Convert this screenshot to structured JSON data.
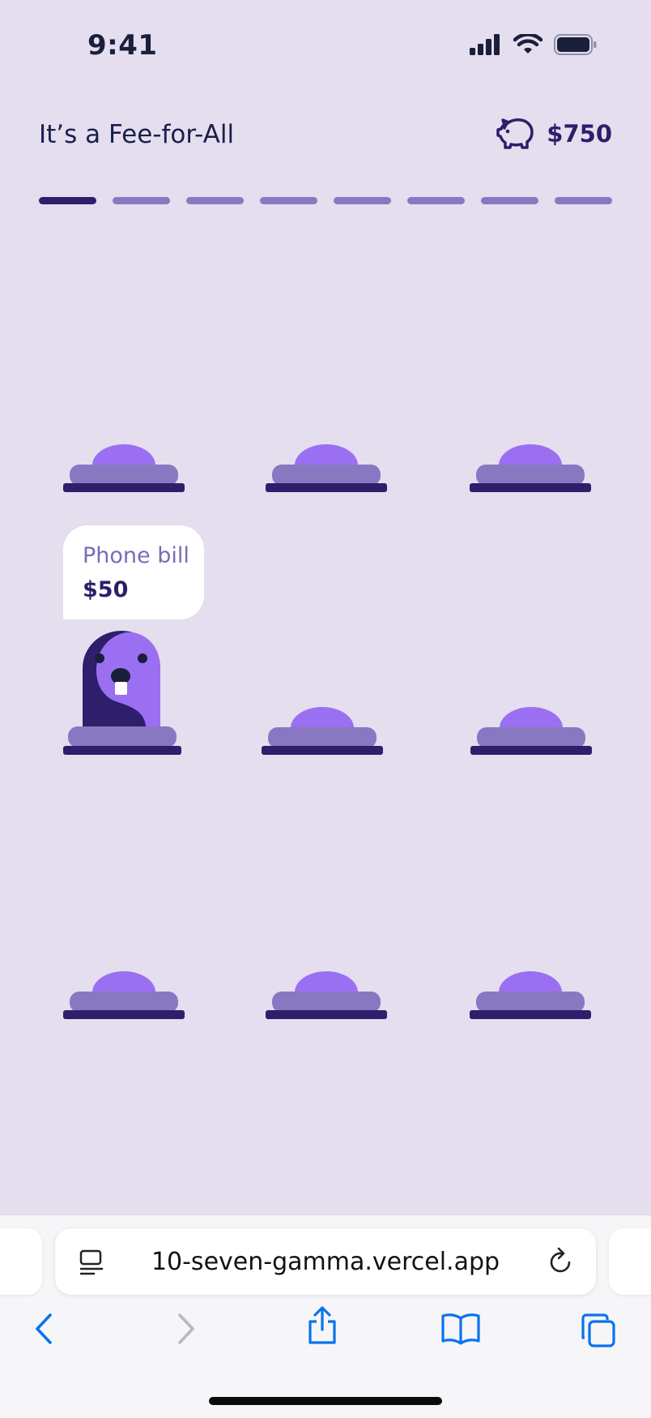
{
  "status_bar": {
    "time": "9:41"
  },
  "header": {
    "title": "It’s a Fee-for-All",
    "balance": "$750"
  },
  "progress": {
    "total_steps": 8,
    "current_step": 1
  },
  "tooltip": {
    "label": "Phone bill",
    "amount": "$50"
  },
  "browser": {
    "url": "10-seven-gamma.vercel.app"
  },
  "colors": {
    "background": "#e4deef",
    "mound_top": "#9b6ff1",
    "mound_mid": "#8878c2",
    "mound_base": "#2d1f6b",
    "accent_dark": "#2b1f6b",
    "ios_blue": "#0a72f0"
  },
  "icons": {
    "balance": "piggy-bank-icon",
    "reader": "reader-mode-icon",
    "reload": "reload-icon",
    "back": "chevron-left-icon",
    "forward": "chevron-right-icon",
    "share": "share-icon",
    "bookmarks": "book-icon",
    "tabs": "tabs-icon"
  }
}
